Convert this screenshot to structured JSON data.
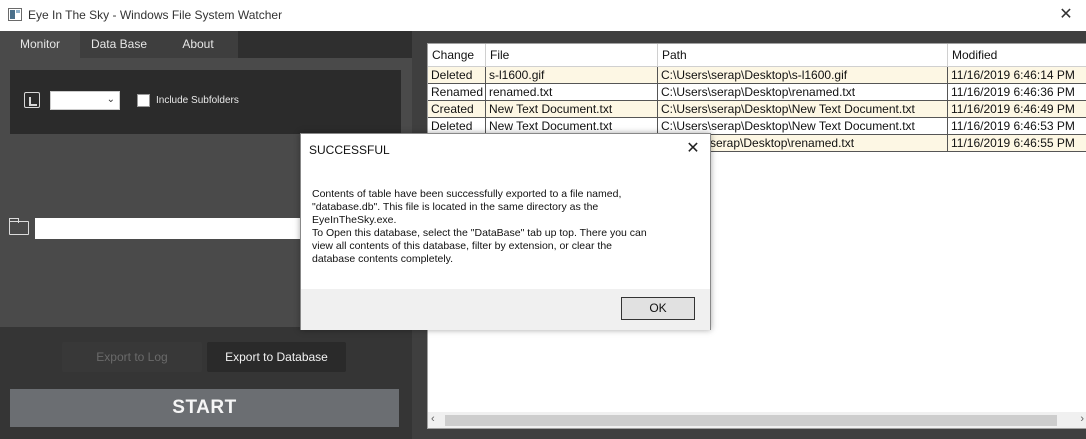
{
  "window": {
    "title": "Eye In The Sky - Windows File System Watcher",
    "close_glyph": "✕"
  },
  "tabs": [
    {
      "label": "Monitor"
    },
    {
      "label": "Data Base"
    },
    {
      "label": "About"
    }
  ],
  "monitor": {
    "drive_select_value": "",
    "drive_caret": "⌄",
    "include_subfolders_label": "Include Subfolders",
    "include_subfolders_checked": false,
    "path_value": "",
    "export_log_label": "Export to Log",
    "export_db_label": "Export to Database",
    "start_label": "START"
  },
  "grid": {
    "headers": [
      "Change",
      "File",
      "Path",
      "Modified"
    ],
    "rows": [
      {
        "change": "Deleted",
        "file": "s-l1600.gif",
        "path": "C:\\Users\\serap\\Desktop\\s-l1600.gif",
        "modified": "11/16/2019 6:46:14 PM"
      },
      {
        "change": "Renamed",
        "file": "renamed.txt",
        "path": "C:\\Users\\serap\\Desktop\\renamed.txt",
        "modified": "11/16/2019 6:46:36 PM"
      },
      {
        "change": "Created",
        "file": "New Text Document.txt",
        "path": "C:\\Users\\serap\\Desktop\\New Text Document.txt",
        "modified": "11/16/2019 6:46:49 PM"
      },
      {
        "change": "Deleted",
        "file": "New Text Document.txt",
        "path": "C:\\Users\\serap\\Desktop\\New Text Document.txt",
        "modified": "11/16/2019 6:46:53 PM"
      },
      {
        "change": "",
        "file": "",
        "path": "serap\\Desktop\\renamed.txt",
        "modified": "11/16/2019 6:46:55 PM"
      }
    ],
    "scroll_left_glyph": "‹",
    "scroll_right_glyph": "›"
  },
  "dialog": {
    "title": "SUCCESSFUL",
    "close_glyph": "✕",
    "line1": "Contents of table have been successfully exported to a file named,",
    "line2": "\"database.db\". This file is located in the same directory as the",
    "line3": "EyeInTheSky.exe.",
    "line4": "To Open this database, select the \"DataBase\" tab up top. There you can",
    "line5": "view all contents of this database, filter by extension, or clear the",
    "line6": "database contents completely.",
    "ok_label": "OK"
  },
  "colors": {
    "row_alt": "#fdf7e4",
    "panel_bg": "#4a4a4a",
    "tab_bar": "#2f2f2f",
    "start_button": "#6b6e72"
  }
}
